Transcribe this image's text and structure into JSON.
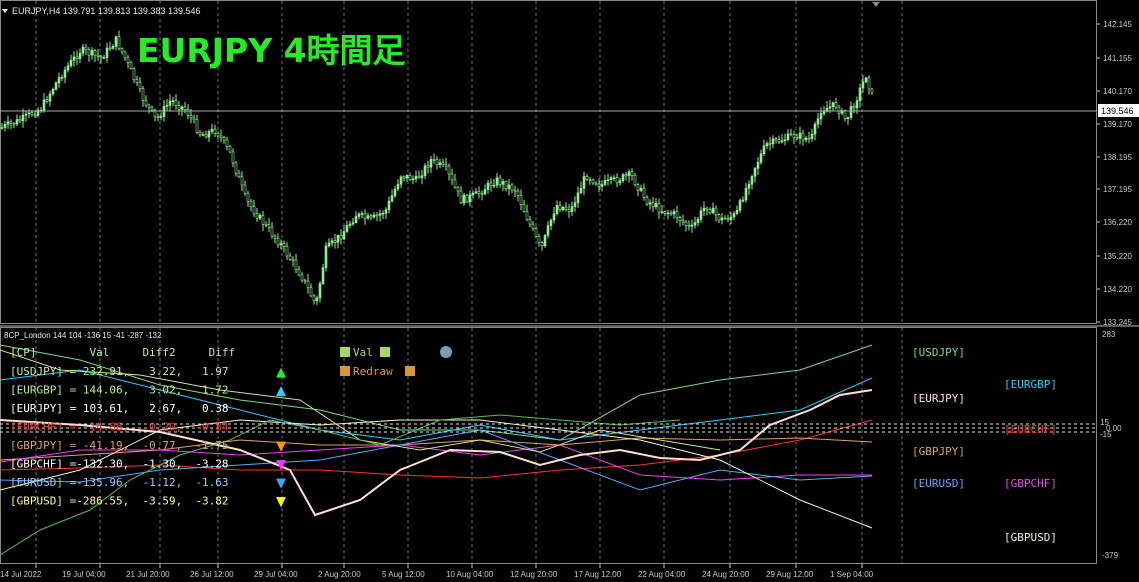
{
  "chart_title": "EURJPY 4時間足",
  "header": {
    "symbol_info": "EURJPY,H4  139.791 139.813 139.383 139.546"
  },
  "indicator_header": "8CP_London 144 104 -136 15 -41 -287 -132",
  "colors": {
    "background": "#000000",
    "candle": "#90ee90",
    "title_green": "#22ee22",
    "grid": "#6f6f6f",
    "axis_text": "#c8c8c8"
  },
  "price_axis": {
    "ticks": [
      "142.145",
      "141.155",
      "140.170",
      "139.170",
      "138.195",
      "137.195",
      "136.220",
      "135.220",
      "134.220",
      "133.245"
    ],
    "current_price": "139.546"
  },
  "time_axis": {
    "labels": [
      "14 Jul 2022",
      "19 Jul 04:00",
      "21 Jul 20:00",
      "26 Jul 12:00",
      "29 Jul 04:00",
      "2 Aug 20:00",
      "5 Aug 12:00",
      "10 Aug 04:00",
      "12 Aug 20:00",
      "17 Aug 12:00",
      "22 Aug 04:00",
      "24 Aug 20:00",
      "29 Aug 12:00",
      "1 Sep 04:00"
    ]
  },
  "indicator_axis": {
    "top": "283",
    "bottom": "-379",
    "right_labels": [
      "15",
      "0.00",
      "-15"
    ]
  },
  "indicator_table": {
    "header": "[CP]        Val     Diff2     Diff",
    "rows": [
      {
        "text": "[USDJPY] = 232.91,   3.22,   1.97",
        "color": "#b9ef8f",
        "mark": "▲",
        "mark_color": "#22ee22"
      },
      {
        "text": "[EURGBP] = 144.06,   3.02,   1.72",
        "color": "#b9ef8f",
        "mark": "▲",
        "mark_color": "#33ccff"
      },
      {
        "text": "[EURJPY] = 103.61,   2.67,   0.38",
        "color": "#ffffff",
        "mark": "",
        "mark_color": ""
      },
      {
        "text": "[EURCHF] =  14.86,  -0.20,  -0.84",
        "color": "#ff3030",
        "mark": "",
        "mark_color": ""
      },
      {
        "text": "[GBPJPY] = -41.19,  -0.77,  -1.75",
        "color": "#e0a060",
        "mark": "▼",
        "mark_color": "#ff9900"
      },
      {
        "text": "[GBPCHF] =-132.30,  -1.30,  -3.28",
        "color": "#ffffff",
        "mark": "▼",
        "mark_color": "#ff33ff"
      },
      {
        "text": "[EURUSD] =-135.96,  -1.12,  -1.63",
        "color": "#9ac8ff",
        "mark": "▼",
        "mark_color": "#33aaff"
      },
      {
        "text": "[GBPUSD] =-286.55,  -3.59,  -3.82",
        "color": "#ffff80",
        "mark": "▼",
        "mark_color": "#ffff00"
      }
    ],
    "legend_val": "Val",
    "legend_redraw": "Redraw"
  },
  "pair_labels": [
    {
      "text": "[USDJPY]",
      "color": "#7ed97e"
    },
    {
      "text": "[EURGBP]",
      "color": "#33ccff"
    },
    {
      "text": "[EURJPY]",
      "color": "#ffe0d0"
    },
    {
      "text": "[EURCHF]",
      "color": "#ff3030"
    },
    {
      "text": "[GBPJPY]",
      "color": "#e0a060"
    },
    {
      "text": "[EURUSD]",
      "color": "#5aa8ff"
    },
    {
      "text": "[GBPCHF]",
      "color": "#ee44ee"
    },
    {
      "text": "[GBPUSD]",
      "color": "#f5f5c0"
    }
  ]
}
